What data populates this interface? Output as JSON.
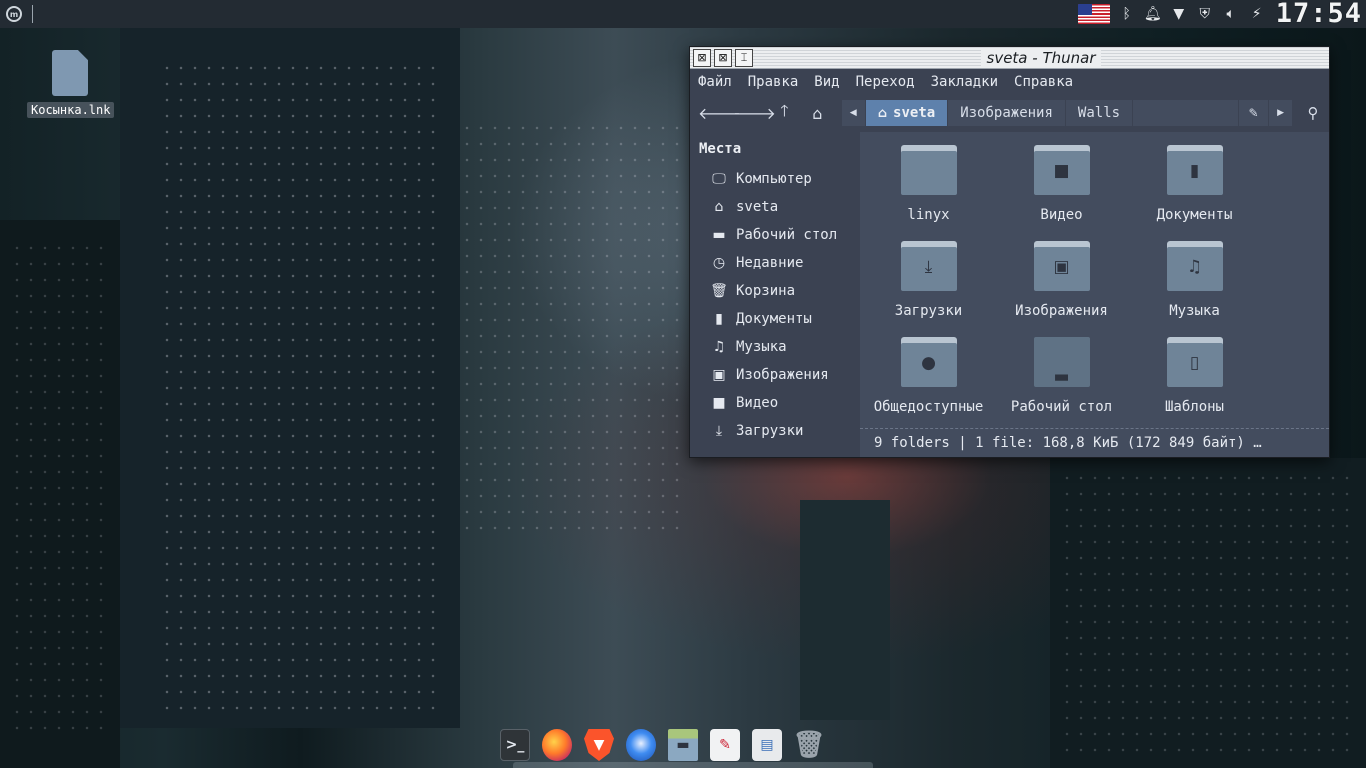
{
  "top_panel": {
    "clock": "17:54",
    "tray_icons": [
      "us-flag-icon",
      "bluetooth-icon",
      "notification-bell-icon",
      "wifi-icon",
      "shield-icon",
      "volume-icon",
      "power-plug-icon"
    ]
  },
  "desktop": {
    "icons": [
      {
        "label": "Косынка.lnk",
        "icon": "file-icon"
      }
    ]
  },
  "window": {
    "title": "sveta - Thunar",
    "menu": [
      "Файл",
      "Правка",
      "Вид",
      "Переход",
      "Закладки",
      "Справка"
    ],
    "pathbar": {
      "active": "sveta",
      "crumbs": [
        "Изображения",
        "Walls"
      ]
    },
    "sidebar": {
      "heading": "Места",
      "items": [
        {
          "label": "Компьютер",
          "icon": "computer-icon"
        },
        {
          "label": "sveta",
          "icon": "home-icon"
        },
        {
          "label": "Рабочий стол",
          "icon": "desktop-icon"
        },
        {
          "label": "Недавние",
          "icon": "clock-icon"
        },
        {
          "label": "Корзина",
          "icon": "trash-icon"
        },
        {
          "label": "Документы",
          "icon": "document-icon"
        },
        {
          "label": "Музыка",
          "icon": "music-icon"
        },
        {
          "label": "Изображения",
          "icon": "image-icon"
        },
        {
          "label": "Видео",
          "icon": "video-icon"
        },
        {
          "label": "Загрузки",
          "icon": "download-icon"
        }
      ]
    },
    "folders": [
      {
        "label": "linyx",
        "icon": "folder-icon"
      },
      {
        "label": "Видео",
        "icon": "folder-video-icon"
      },
      {
        "label": "Документы",
        "icon": "folder-documents-icon"
      },
      {
        "label": "Загрузки",
        "icon": "folder-download-icon"
      },
      {
        "label": "Изображения",
        "icon": "folder-pictures-icon"
      },
      {
        "label": "Музыка",
        "icon": "folder-music-icon"
      },
      {
        "label": "Общедоступные",
        "icon": "folder-public-icon"
      },
      {
        "label": "Рабочий стол",
        "icon": "folder-desktop-icon"
      },
      {
        "label": "Шаблоны",
        "icon": "folder-templates-icon"
      }
    ],
    "status": "9 folders  |  1 file: 168,8 КиБ (172 849 байт)  …"
  },
  "dock": {
    "apps": [
      "terminal-icon",
      "firefox-icon",
      "brave-icon",
      "thunderbird-icon",
      "archive-manager-icon",
      "text-editor-icon",
      "presentation-icon",
      "trash-icon"
    ]
  }
}
